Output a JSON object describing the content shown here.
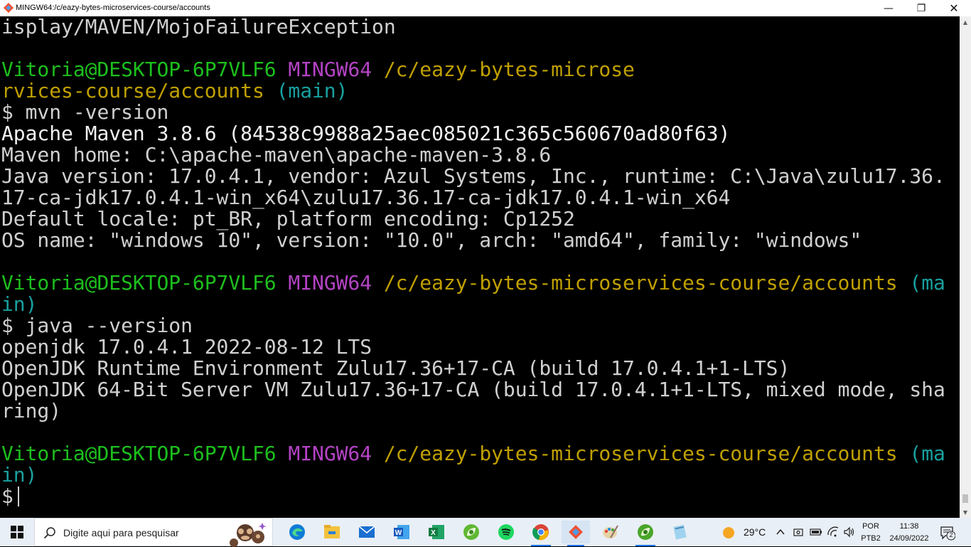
{
  "window": {
    "title": "MINGW64:/c/eazy-bytes-microservices-course/accounts",
    "minimize_glyph": "—",
    "maximize_glyph": "❐",
    "close_glyph": "✕"
  },
  "terminal": {
    "lines": [
      [
        {
          "t": "isplay/MAVEN/MojoFailureException",
          "c": "default"
        }
      ],
      [],
      [
        {
          "t": "Vitoria@DESKTOP-6P7VLF6 ",
          "c": "green"
        },
        {
          "t": "MINGW64 ",
          "c": "magenta"
        },
        {
          "t": "/c/eazy-bytes-microse",
          "c": "yellow"
        }
      ],
      [
        {
          "t": "rvices-course/accounts ",
          "c": "yellow"
        },
        {
          "t": "(main)",
          "c": "cyan"
        }
      ],
      [
        {
          "t": "$ mvn -version",
          "c": "default"
        }
      ],
      [
        {
          "t": "Apache Maven 3.8.6 (84538c9988a25aec085021c365c560670ad80f63)",
          "c": "white"
        }
      ],
      [
        {
          "t": "Maven home: C:\\apache-maven\\apache-maven-3.8.6",
          "c": "default"
        }
      ],
      [
        {
          "t": "Java version: 17.0.4.1, vendor: Azul Systems, Inc., runtime: C:\\Java\\zulu17.36.",
          "c": "default"
        }
      ],
      [
        {
          "t": "17-ca-jdk17.0.4.1-win_x64\\zulu17.36.17-ca-jdk17.0.4.1-win_x64",
          "c": "default"
        }
      ],
      [
        {
          "t": "Default locale: pt_BR, platform encoding: Cp1252",
          "c": "default"
        }
      ],
      [
        {
          "t": "OS name: \"windows 10\", version: \"10.0\", arch: \"amd64\", family: \"windows\"",
          "c": "default"
        }
      ],
      [],
      [
        {
          "t": "Vitoria@DESKTOP-6P7VLF6 ",
          "c": "green"
        },
        {
          "t": "MINGW64 ",
          "c": "magenta"
        },
        {
          "t": "/c/eazy-bytes-microservices-course/accounts ",
          "c": "yellow"
        },
        {
          "t": "(ma",
          "c": "cyan"
        }
      ],
      [
        {
          "t": "in)",
          "c": "cyan"
        }
      ],
      [
        {
          "t": "$ java --version",
          "c": "default"
        }
      ],
      [
        {
          "t": "openjdk 17.0.4.1 2022-08-12 LTS",
          "c": "default"
        }
      ],
      [
        {
          "t": "OpenJDK Runtime Environment Zulu17.36+17-CA (build 17.0.4.1+1-LTS)",
          "c": "default"
        }
      ],
      [
        {
          "t": "OpenJDK 64-Bit Server VM Zulu17.36+17-CA (build 17.0.4.1+1-LTS, mixed mode, sha",
          "c": "default"
        }
      ],
      [
        {
          "t": "ring)",
          "c": "default"
        }
      ],
      [],
      [
        {
          "t": "Vitoria@DESKTOP-6P7VLF6 ",
          "c": "green"
        },
        {
          "t": "MINGW64 ",
          "c": "magenta"
        },
        {
          "t": "/c/eazy-bytes-microservices-course/accounts ",
          "c": "yellow"
        },
        {
          "t": "(ma",
          "c": "cyan"
        }
      ],
      [
        {
          "t": "in)",
          "c": "cyan"
        }
      ]
    ],
    "prompt": "$"
  },
  "colors": {
    "default": "#d0d0d0",
    "green": "#1dbf1d",
    "magenta": "#b343c4",
    "yellow": "#c0a000",
    "cyan": "#19a0a0",
    "white": "#f2f2f2",
    "taskbar_bg": "#e9eff6"
  },
  "taskbar": {
    "search_placeholder": "Digite aqui para pesquisar",
    "apps": [
      {
        "name": "edge",
        "icon": "edge-icon"
      },
      {
        "name": "file-explorer",
        "icon": "folder-icon"
      },
      {
        "name": "mail",
        "icon": "mail-icon"
      },
      {
        "name": "word",
        "icon": "word-icon"
      },
      {
        "name": "excel",
        "icon": "excel-icon"
      },
      {
        "name": "spring-tool",
        "icon": "spring-leaf-icon"
      },
      {
        "name": "spotify",
        "icon": "spotify-icon"
      },
      {
        "name": "chrome",
        "icon": "chrome-icon"
      },
      {
        "name": "git-bash",
        "icon": "git-icon"
      },
      {
        "name": "paint",
        "icon": "paint-icon"
      },
      {
        "name": "spring-tool-2",
        "icon": "spring-leaf-icon"
      },
      {
        "name": "notepad",
        "icon": "notepad-icon"
      }
    ],
    "weather_temp": "29°C",
    "language_top": "POR",
    "language_bottom": "PTB2",
    "time": "11:38",
    "date": "24/09/2022",
    "notification_count": "2"
  }
}
